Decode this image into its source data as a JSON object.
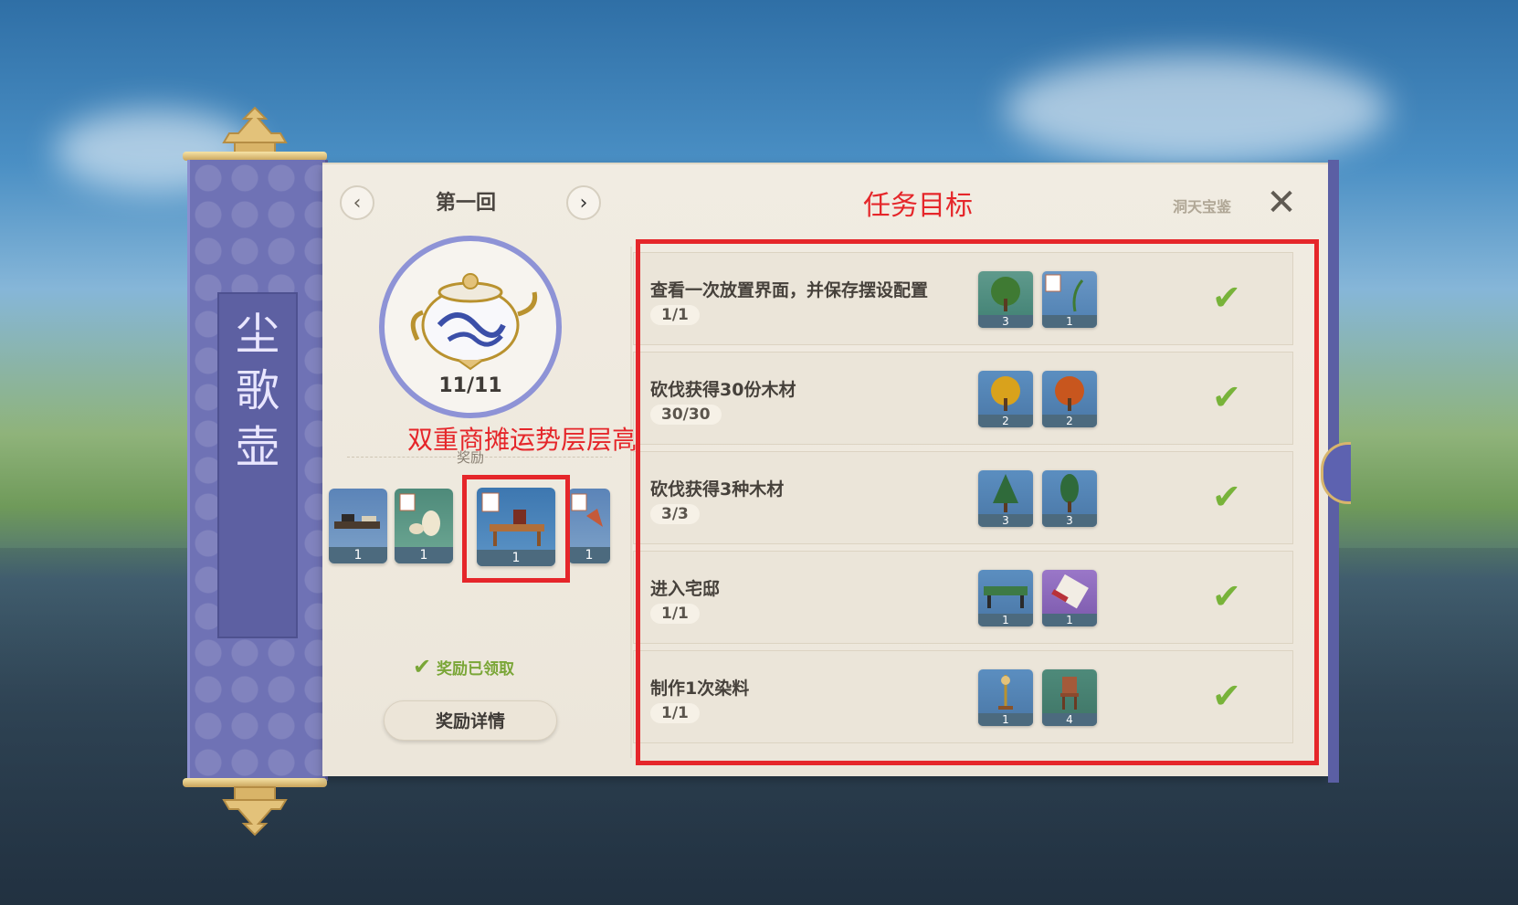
{
  "left_panel": {
    "rod_title": "尘歌壶",
    "chapter": "第一回",
    "prev_icon": "chevron-left",
    "next_icon": "chevron-right",
    "progress": "11/11",
    "annotation": "双重商摊运势层层高",
    "reward_label": "奖励",
    "rewards": [
      {
        "count": "1",
        "icon": "writing-desk"
      },
      {
        "count": "1",
        "icon": "vases"
      },
      {
        "count": "1",
        "icon": "tea-table"
      },
      {
        "count": "1",
        "icon": "decor"
      }
    ],
    "claimed_text": "奖励已领取",
    "detail_button": "奖励详情"
  },
  "header": {
    "title": "任务目标",
    "treasure_label": "洞天宝鉴",
    "close_icon": "close"
  },
  "tasks": [
    {
      "text": "查看一次放置界面，并保存摆设配置",
      "progress": "1/1",
      "rewards": [
        {
          "count": "3"
        },
        {
          "count": "1"
        }
      ],
      "done": true
    },
    {
      "text": "砍伐获得30份木材",
      "progress": "30/30",
      "rewards": [
        {
          "count": "2"
        },
        {
          "count": "2"
        }
      ],
      "done": true
    },
    {
      "text": "砍伐获得3种木材",
      "progress": "3/3",
      "rewards": [
        {
          "count": "3"
        },
        {
          "count": "3"
        }
      ],
      "done": true
    },
    {
      "text": "进入宅邸",
      "progress": "1/1",
      "rewards": [
        {
          "count": "1"
        },
        {
          "count": "1"
        }
      ],
      "done": true
    },
    {
      "text": "制作1次染料",
      "progress": "1/1",
      "rewards": [
        {
          "count": "1"
        },
        {
          "count": "4"
        }
      ],
      "done": true
    }
  ],
  "colors": {
    "accent_red": "#e5262a",
    "check_green": "#78b33a",
    "rod_purple": "#6f72b5"
  }
}
